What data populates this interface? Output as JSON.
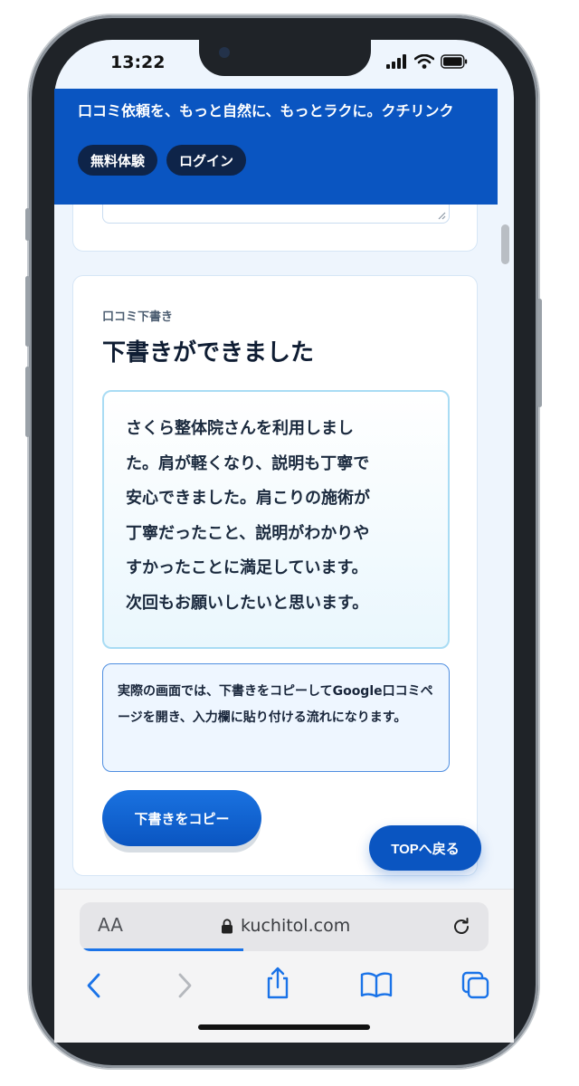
{
  "status_bar": {
    "time": "13:22"
  },
  "header": {
    "title": "口コミ依頼を、もっと自然に、もっとラクに。クチリンク",
    "buttons": {
      "free_trial": "無料体験",
      "login": "ログイン"
    }
  },
  "draft_card": {
    "label": "口コミ下書き",
    "title": "下書きができました",
    "draft_lines": [
      "さくら整体院さんを利用しまし",
      "た。肩が軽くなり、説明も丁寧で",
      "安心できました。肩こりの施術が",
      "丁寧だったこと、説明がわかりや",
      "すかったことに満足しています。",
      "次回もお願いしたいと思います。"
    ],
    "note": "実際の画面では、下書きをコピーしてGoogle口コミページを開き、入力欄に貼り付ける流れになります。",
    "copy_button": "下書きをコピー"
  },
  "floating": {
    "top_button": "TOPへ戻る"
  },
  "browser": {
    "text_size_label": "AA",
    "url": "kuchitol.com",
    "load_progress": 0.4
  },
  "colors": {
    "brand_blue": "#0a55c1",
    "dark_navy": "#0e2449",
    "draft_border": "#a9dcf4",
    "note_border": "#4f8ee0"
  },
  "icons": [
    "signal-icon",
    "wifi-icon",
    "battery-icon",
    "lock-icon",
    "reload-icon",
    "back-icon",
    "forward-icon",
    "share-icon",
    "bookmarks-icon",
    "tabs-icon"
  ]
}
